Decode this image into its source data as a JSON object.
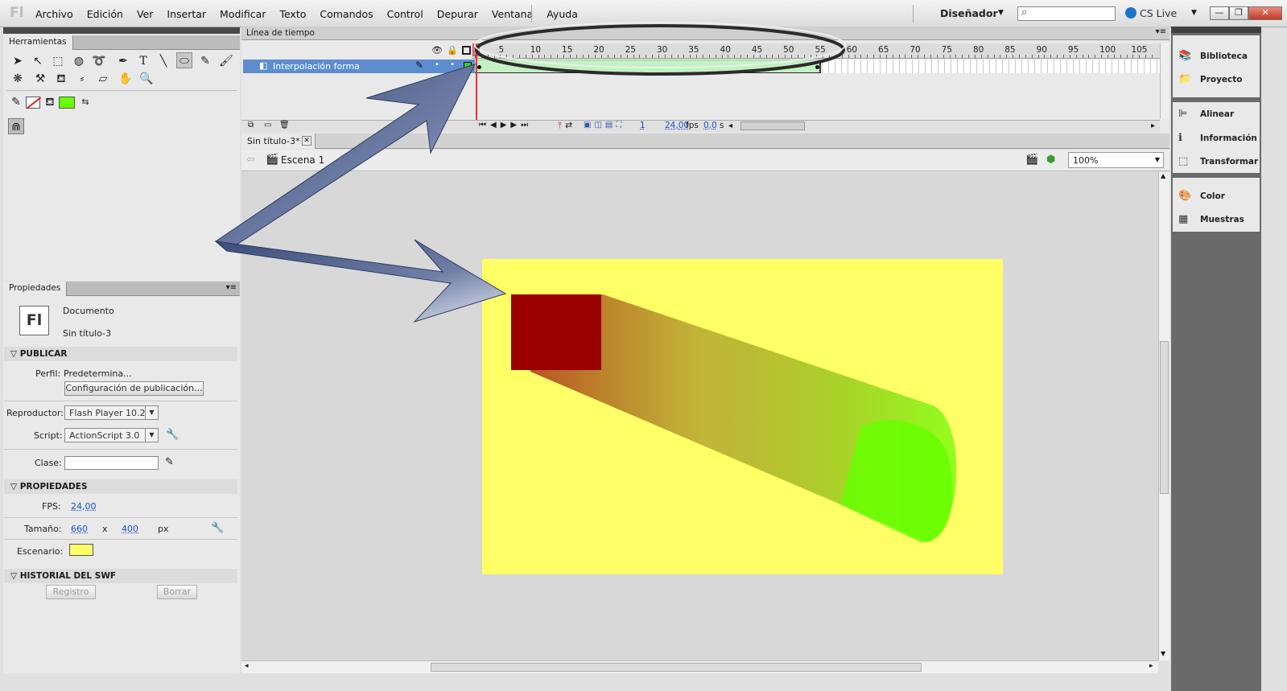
{
  "app": {
    "logo": "Fl",
    "menu": [
      "Archivo",
      "Edición",
      "Ver",
      "Insertar",
      "Modificar",
      "Texto",
      "Comandos",
      "Control",
      "Depurar",
      "Ventana",
      "Ayuda"
    ],
    "workspace": "Diseñador",
    "cslive": "CS Live",
    "window_buttons": [
      "minimize-icon",
      "restore-icon",
      "close-icon"
    ]
  },
  "tools_panel": {
    "title": "Herramientas"
  },
  "properties_panel": {
    "title": "Propiedades",
    "doc_type": "Documento",
    "doc_name": "Sin título-3",
    "doc_icon": "Fl",
    "sections": {
      "publish": "PUBLICAR",
      "props": "PROPIEDADES",
      "history": "HISTORIAL DEL SWF"
    },
    "profile_label": "Perfil:",
    "profile_value": "Predetermina...",
    "publish_settings_button": "Configuración de publicación...",
    "player_label": "Reproductor:",
    "player_value": "Flash Player 10.2",
    "script_label": "Script:",
    "script_value": "ActionScript 3.0",
    "class_label": "Clase:",
    "class_value": "",
    "fps_label": "FPS:",
    "fps_value": "24,00",
    "size_label": "Tamaño:",
    "width": "660",
    "times": "x",
    "height": "400",
    "unit": "px",
    "stage_label": "Escenario:",
    "stage_color": "#ffff66",
    "log_button": "Registro",
    "clear_button": "Borrar"
  },
  "timeline": {
    "title": "Línea de tiempo",
    "layer_name": "Interpolación forma",
    "ruler_numbers": [
      "5",
      "10",
      "15",
      "20",
      "25",
      "30",
      "35",
      "40",
      "45",
      "50",
      "55",
      "60",
      "65",
      "70",
      "75",
      "80",
      "85",
      "90",
      "95",
      "100",
      "105"
    ],
    "current_frame": "1",
    "fps": "24,00",
    "fps_unit": "fps",
    "time": "0,0",
    "time_unit": "s",
    "tween_color": "#c4f0c4",
    "layer_highlight": "#5d8dd0"
  },
  "document": {
    "tab_title": "Sin título-3*",
    "scene": "Escena 1",
    "zoom": "100%",
    "stage_color": "#ffff66",
    "shape_start_color": "#990000",
    "shape_end_color": "#66ff00"
  },
  "right_panel": {
    "items": [
      "Biblioteca",
      "Proyecto",
      "Alinear",
      "Información",
      "Transformar",
      "Color",
      "Muestras"
    ]
  }
}
